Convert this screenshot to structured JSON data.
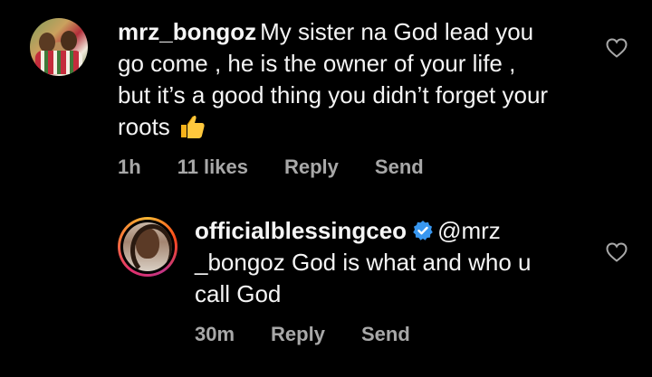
{
  "comments": [
    {
      "username": "mrz_bongoz",
      "text": "My sister na God lead you go come , he is the owner of your life , but it’s a good thing you didn’t forget your roots",
      "emoji": "thumbs-up-emoji",
      "time": "1h",
      "likes": "11 likes",
      "reply_label": "Reply",
      "send_label": "Send",
      "like_icon": "heart-outline-icon"
    },
    {
      "username": "officialblessingceo",
      "verified": true,
      "text": "@mrz _bongoz God is what and who u call God",
      "time": "30m",
      "reply_label": "Reply",
      "send_label": "Send",
      "like_icon": "heart-outline-icon"
    }
  ],
  "colors": {
    "background": "#000000",
    "text": "#f5f5f5",
    "meta": "#a8a8a8",
    "verified_badge": "#3897f0",
    "story_ring": "#e1306c"
  }
}
